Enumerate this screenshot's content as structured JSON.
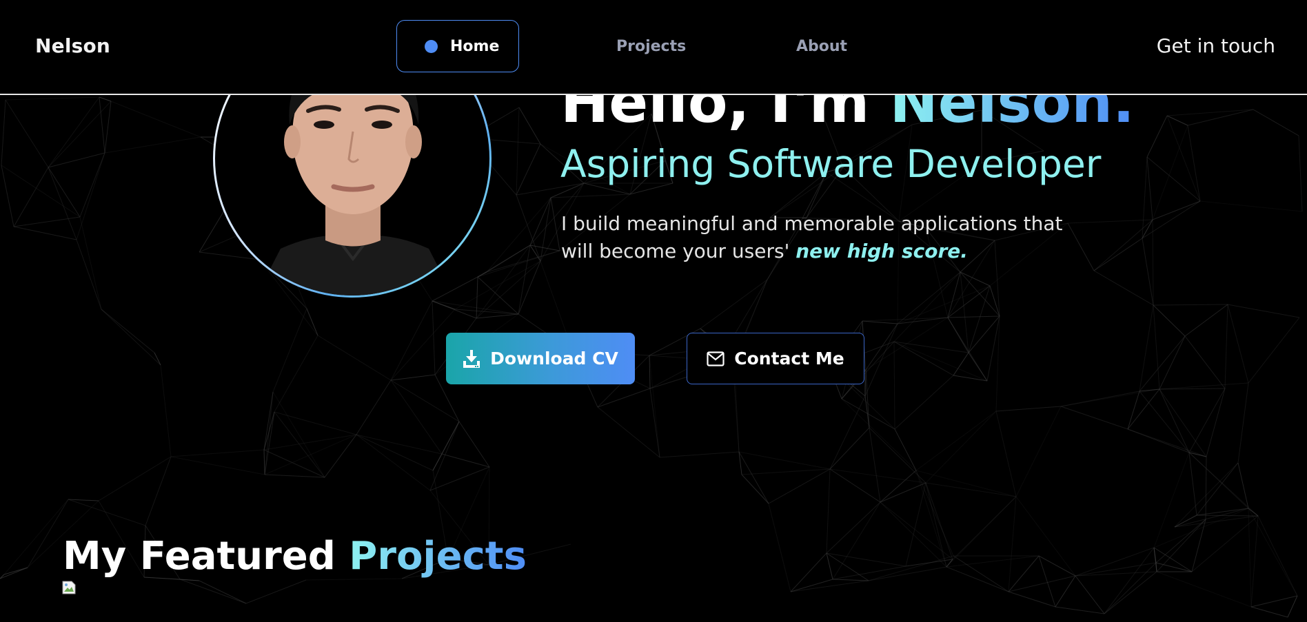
{
  "navbar": {
    "brand": "Nelson",
    "links": [
      {
        "label": "Home",
        "active": true
      },
      {
        "label": "Projects",
        "active": false
      },
      {
        "label": "About",
        "active": false
      }
    ],
    "cta": "Get in touch"
  },
  "hero": {
    "title_prefix": "Hello, I'm ",
    "title_name": "Nelson.",
    "subtitle": "Aspiring Software Developer",
    "description": "I build meaningful and memorable applications that will become your users' ",
    "description_highlight": "new high score.",
    "download_button": "Download CV",
    "contact_button": "Contact Me"
  },
  "featured": {
    "title_prefix": "My Featured ",
    "title_accent": "Projects"
  },
  "colors": {
    "accent_blue": "#4f8df5",
    "accent_cyan": "#8ef0ef",
    "background": "#000000",
    "network_lines": "#3a3a3a"
  }
}
